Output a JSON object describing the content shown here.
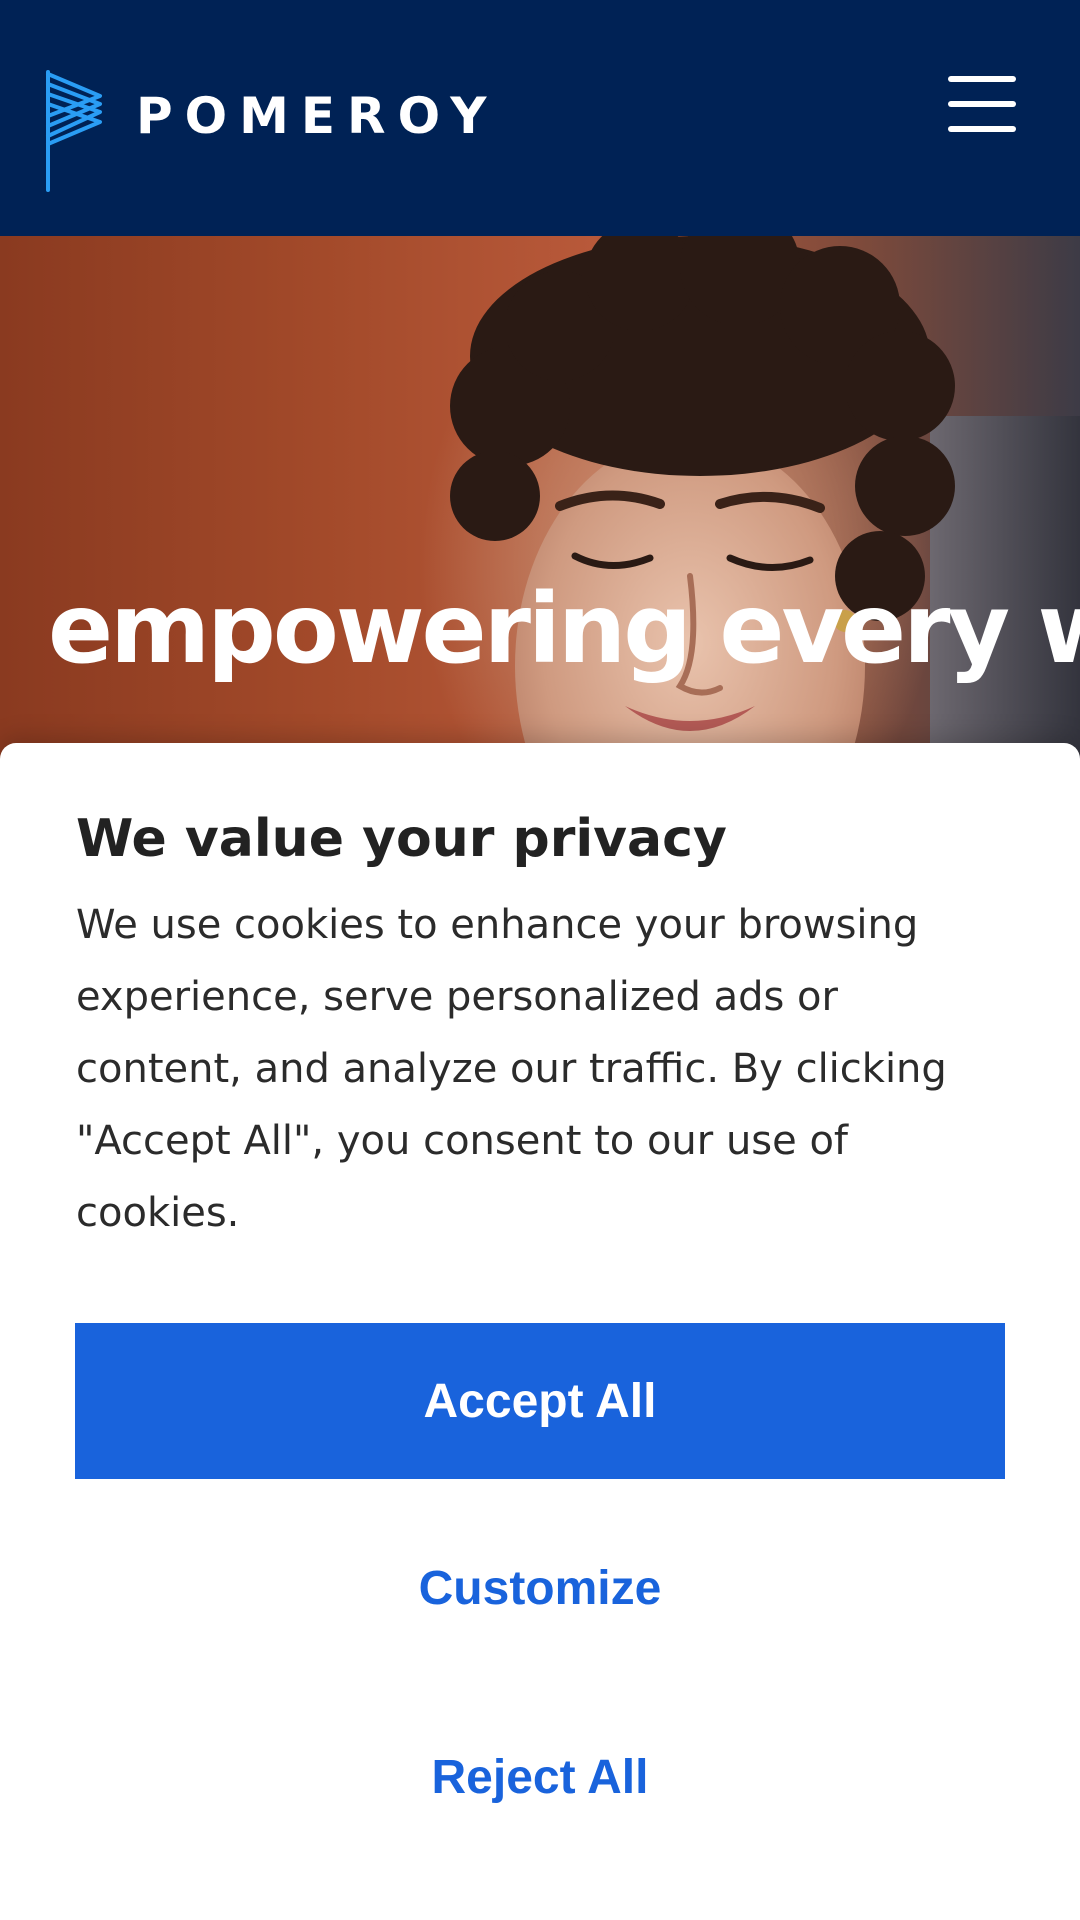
{
  "header": {
    "brand": "POMEROY",
    "logo_icon": "pomeroy-flag-icon",
    "menu_icon": "hamburger-menu-icon"
  },
  "hero": {
    "headline": "empowering every worker"
  },
  "cookie_banner": {
    "title": "We value your privacy",
    "body": "We use cookies to enhance your browsing experience, serve personalized ads or content, and analyze our traffic. By clicking \"Accept All\", you consent to our use of cookies.",
    "accept_label": "Accept All",
    "customize_label": "Customize",
    "reject_label": "Reject All"
  },
  "colors": {
    "header_bg": "#002255",
    "logo_accent": "#2a9df4",
    "primary_button": "#1963dc",
    "link_text": "#1963dc",
    "banner_bg": "#ffffff",
    "title_text": "#222222"
  }
}
